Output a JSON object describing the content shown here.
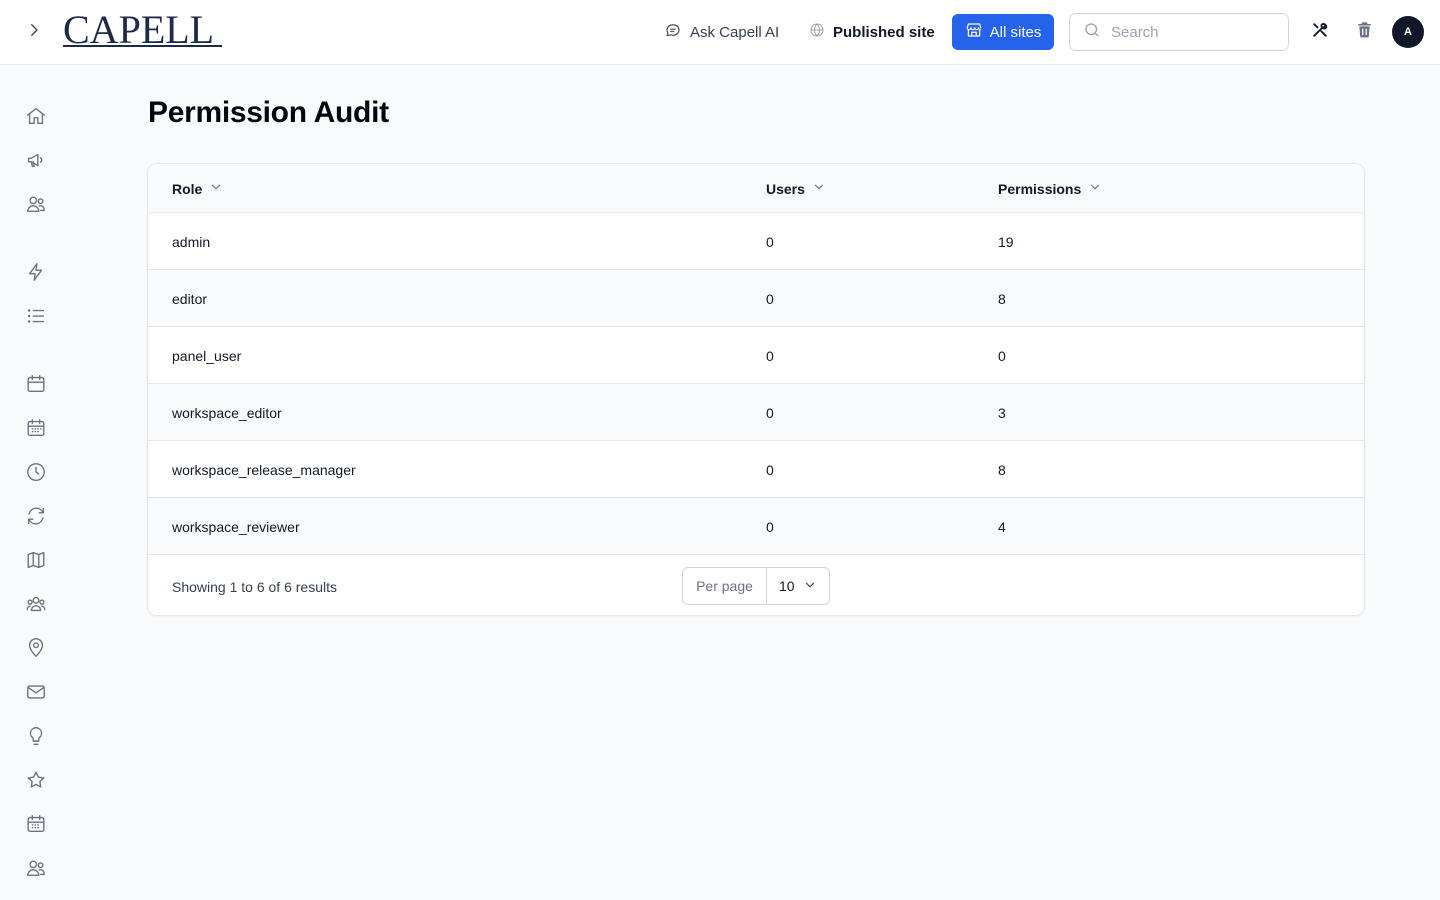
{
  "header": {
    "logo": "CAPELL",
    "ask_ai": "Ask Capell AI",
    "published_site": "Published site",
    "all_sites": "All sites",
    "search_placeholder": "Search",
    "avatar_initial": "A"
  },
  "sidebar": {
    "icons": [
      "home-icon",
      "megaphone-icon",
      "users-icon",
      "lightning-icon",
      "list-icon",
      "calendar-icon",
      "calendar-grid-icon",
      "clock-icon",
      "refresh-icon",
      "map-icon",
      "user-group-icon",
      "map-pin-icon",
      "envelope-icon",
      "lightbulb-icon",
      "star-icon",
      "calendar-days-icon",
      "users-alt-icon"
    ]
  },
  "page": {
    "title": "Permission Audit"
  },
  "table": {
    "columns": [
      "Role",
      "Users",
      "Permissions"
    ],
    "rows": [
      {
        "role": "admin",
        "users": "0",
        "permissions": "19"
      },
      {
        "role": "editor",
        "users": "0",
        "permissions": "8"
      },
      {
        "role": "panel_user",
        "users": "0",
        "permissions": "0"
      },
      {
        "role": "workspace_editor",
        "users": "0",
        "permissions": "3"
      },
      {
        "role": "workspace_release_manager",
        "users": "0",
        "permissions": "8"
      },
      {
        "role": "workspace_reviewer",
        "users": "0",
        "permissions": "4"
      }
    ],
    "results_text": "Showing 1 to 6 of 6 results",
    "per_page_label": "Per page",
    "per_page_value": "10"
  },
  "colors": {
    "accent": "#2563eb",
    "avatar_bg": "#111827"
  }
}
